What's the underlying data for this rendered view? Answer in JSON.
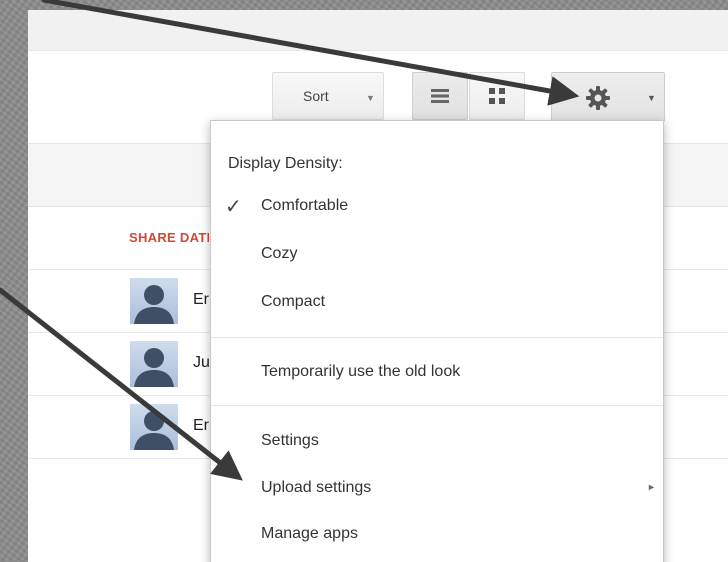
{
  "toolbar": {
    "sort_label": "Sort",
    "sort_caret": "▼",
    "gear_caret": "▼"
  },
  "list": {
    "column_header": "SHARE DATE",
    "rows": [
      {
        "name": "Er"
      },
      {
        "name": "Ju"
      },
      {
        "name": "Er"
      }
    ]
  },
  "settings_menu": {
    "heading": "Display Density:",
    "check_mark": "✓",
    "items": [
      {
        "label": "Comfortable"
      },
      {
        "label": "Cozy"
      },
      {
        "label": "Compact"
      },
      {
        "label": "Temporarily use the old look"
      },
      {
        "label": "Settings"
      },
      {
        "label": "Upload settings"
      },
      {
        "label": "Manage apps"
      }
    ],
    "submenu_arrow": "►",
    "selected_density": "Comfortable"
  },
  "colors": {
    "accent_header": "#d14836",
    "arrow": "#3a3a3a",
    "menu_border": "#c9c9c9"
  },
  "icons": {
    "gear": "gear-icon",
    "list_view": "list-view-icon",
    "grid_view": "grid-view-icon",
    "avatar": "person-silhouette-icon"
  }
}
